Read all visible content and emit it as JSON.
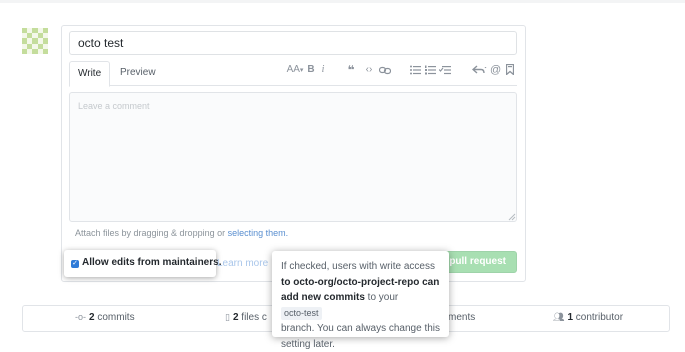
{
  "composer": {
    "title_value": "octo test",
    "tabs": [
      {
        "label": "Write",
        "active": true
      },
      {
        "label": "Preview",
        "active": false
      }
    ],
    "toolbar": {
      "heading_glyph": "AA",
      "bold_glyph": "B",
      "italic_glyph": "i",
      "icons": [
        "text-size-icon",
        "bold-icon",
        "italic-icon",
        "quote-icon",
        "code-icon",
        "link-icon",
        "unordered-list-icon",
        "ordered-list-icon",
        "task-list-icon",
        "reply-icon",
        "mention-icon",
        "bookmark-icon"
      ]
    },
    "body_placeholder": "Leave a comment",
    "attach_text": "Attach files by dragging & dropping or ",
    "attach_link": "selecting them.",
    "allow_edits_label": "Allow edits from maintainers.",
    "allow_edits_checked": true,
    "learn_more": "Learn more",
    "submit_label": "pull request"
  },
  "tooltip": {
    "line1": "If checked, users with write access",
    "line2_bold": "to octo-org/octo-project-repo can",
    "line3_bold": "add new commits",
    "line3_rest": " to your ",
    "branch": "octo-test",
    "line4": "branch. You can always change this",
    "line5": "setting later."
  },
  "stats": {
    "commits_count": "2",
    "commits_label": "commits",
    "files_count": "2",
    "files_label": "files c",
    "comments_label": "ments",
    "contributors_count": "1",
    "contributors_label": "contributor"
  },
  "colors": {
    "accent_blue": "#2f7bd8",
    "link_blue": "#5a8fd0",
    "button_green_disabled": "#a8dfb2"
  }
}
